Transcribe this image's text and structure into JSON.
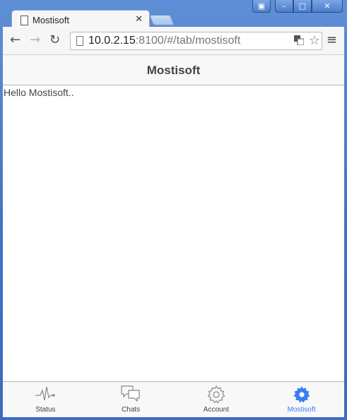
{
  "browser": {
    "tab_title": "Mostisoft",
    "url_host": "10.0.2.15",
    "url_rest": ":8100/#/tab/mostisoft"
  },
  "app": {
    "header_title": "Mostisoft",
    "content_text": "Hello Mostisoft..",
    "accent_color": "#387ef5"
  },
  "tabs": [
    {
      "label": "Status",
      "icon": "pulse-icon",
      "active": false
    },
    {
      "label": "Chats",
      "icon": "chat-bubbles-icon",
      "active": false
    },
    {
      "label": "Account",
      "icon": "gear-outline-icon",
      "active": false
    },
    {
      "label": "Mostisoft",
      "icon": "gear-filled-icon",
      "active": true
    }
  ]
}
